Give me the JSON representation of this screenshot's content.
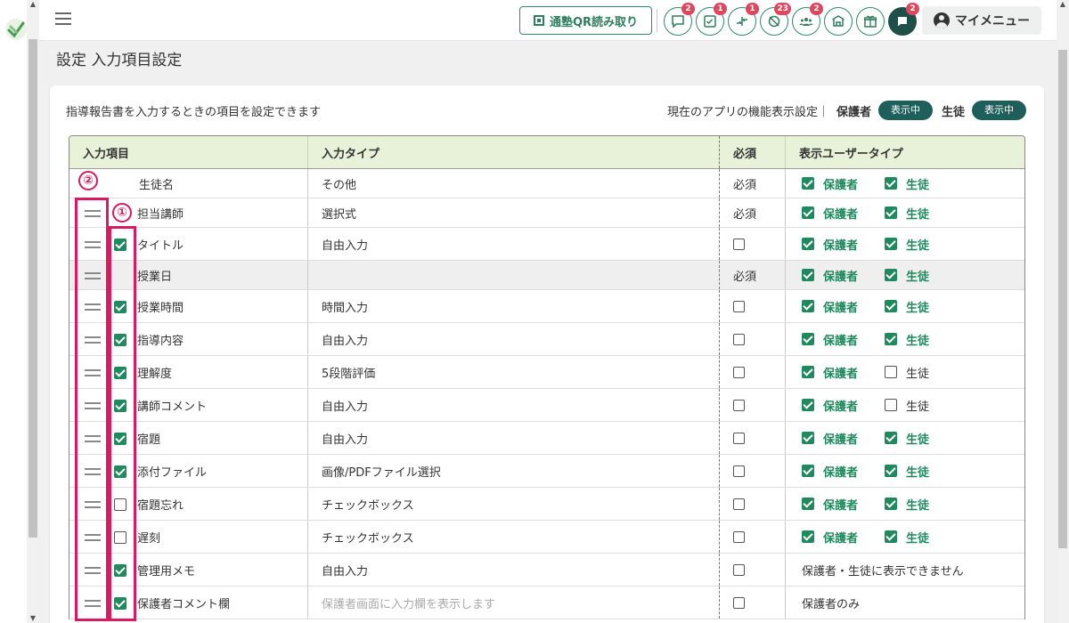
{
  "header": {
    "qr_button_label": "通塾QR読み取り",
    "icons": [
      {
        "name": "chat-icon",
        "badge": "2"
      },
      {
        "name": "checklist-icon",
        "badge": "1"
      },
      {
        "name": "transfer-icon",
        "badge": "1"
      },
      {
        "name": "absence-icon",
        "badge": "23"
      },
      {
        "name": "group-icon",
        "badge": "2"
      },
      {
        "name": "school-icon",
        "badge": ""
      },
      {
        "name": "gift-icon",
        "badge": ""
      },
      {
        "name": "message-icon",
        "badge": "2"
      }
    ],
    "my_menu_label": "マイメニュー"
  },
  "page": {
    "title": "設定 入力項目設定",
    "description": "指導報告書を入力するときの項目を設定できます",
    "app_setting_label": "現在のアプリの機能表示設定｜",
    "guardian_label": "保護者",
    "guardian_state": "表示中",
    "student_label": "生徒",
    "student_state": "表示中"
  },
  "table": {
    "headers": [
      "入力項目",
      "入力タイプ",
      "必須",
      "表示ユーザータイプ"
    ],
    "guardian": "保護者",
    "student": "生徒",
    "rows": [
      {
        "name": "生徒名",
        "type": "その他",
        "required": "必須",
        "drag": false,
        "enable": null,
        "guardian": true,
        "student": true
      },
      {
        "name": "担当講師",
        "type": "選択式",
        "required": "必須",
        "drag": true,
        "enable": null,
        "guardian": true,
        "student": true
      },
      {
        "name": "タイトル",
        "type": "自由入力",
        "required": "",
        "drag": true,
        "enable": true,
        "guardian": true,
        "student": true
      },
      {
        "name": "授業日",
        "type": "",
        "required": "必須",
        "drag": true,
        "enable": null,
        "guardian": true,
        "student": true,
        "gray": true
      },
      {
        "name": "授業時間",
        "type": "時間入力",
        "required": "",
        "drag": true,
        "enable": true,
        "guardian": true,
        "student": true
      },
      {
        "name": "指導内容",
        "type": "自由入力",
        "required": "",
        "drag": true,
        "enable": true,
        "guardian": true,
        "student": true
      },
      {
        "name": "理解度",
        "type": "5段階評価",
        "required": "",
        "drag": true,
        "enable": true,
        "guardian": true,
        "student": false
      },
      {
        "name": "講師コメント",
        "type": "自由入力",
        "required": "",
        "drag": true,
        "enable": true,
        "guardian": true,
        "student": false
      },
      {
        "name": "宿題",
        "type": "自由入力",
        "required": "",
        "drag": true,
        "enable": true,
        "guardian": true,
        "student": true
      },
      {
        "name": "添付ファイル",
        "type": "画像/PDFファイル選択",
        "required": "",
        "drag": true,
        "enable": true,
        "guardian": true,
        "student": true
      },
      {
        "name": "宿題忘れ",
        "type": "チェックボックス",
        "required": "",
        "drag": true,
        "enable": false,
        "guardian": true,
        "student": true
      },
      {
        "name": "遅刻",
        "type": "チェックボックス",
        "required": "",
        "drag": true,
        "enable": false,
        "guardian": true,
        "student": true
      },
      {
        "name": "管理用メモ",
        "type": "自由入力",
        "required": "",
        "drag": true,
        "enable": true,
        "user_text": "保護者・生徒に表示できません"
      },
      {
        "name": "保護者コメント欄",
        "type": "保護者画面に入力欄を表示します",
        "type_muted": true,
        "required": "",
        "drag": true,
        "enable": true,
        "user_text": "保護者のみ"
      }
    ]
  },
  "annotations": {
    "one": "①",
    "two": "②"
  }
}
